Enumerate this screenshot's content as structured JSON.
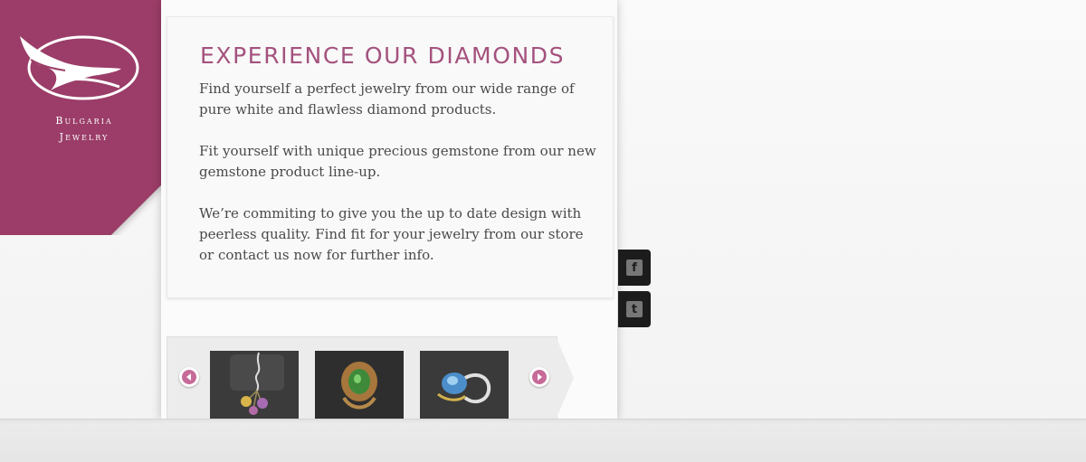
{
  "brand": {
    "name_line1": "Bulgaria",
    "name_line2": "Jewelry",
    "logo_icon": "bird-emblem-icon",
    "color": "#9b3d68"
  },
  "content": {
    "headline": "EXPERIENCE OUR DIAMONDS",
    "paragraphs": [
      "Find yourself a perfect jewelry from our wide range of pure white and flawless diamond products.",
      "Fit yourself with unique precious gemstone from our new gemstone product line-up.",
      "We’re commiting to give you the up to date design with peerless quality. Find fit for your jewelry from our store or contact us now for further info."
    ],
    "headline_color": "#a4527e"
  },
  "carousel": {
    "prev_icon": "chevron-left-icon",
    "next_icon": "chevron-right-icon",
    "items": [
      {
        "icon": "pendant-necklace-image"
      },
      {
        "icon": "emerald-ring-image"
      },
      {
        "icon": "sapphire-ring-image"
      }
    ]
  },
  "social": {
    "facebook_label": "f",
    "tumblr_label": "t"
  }
}
